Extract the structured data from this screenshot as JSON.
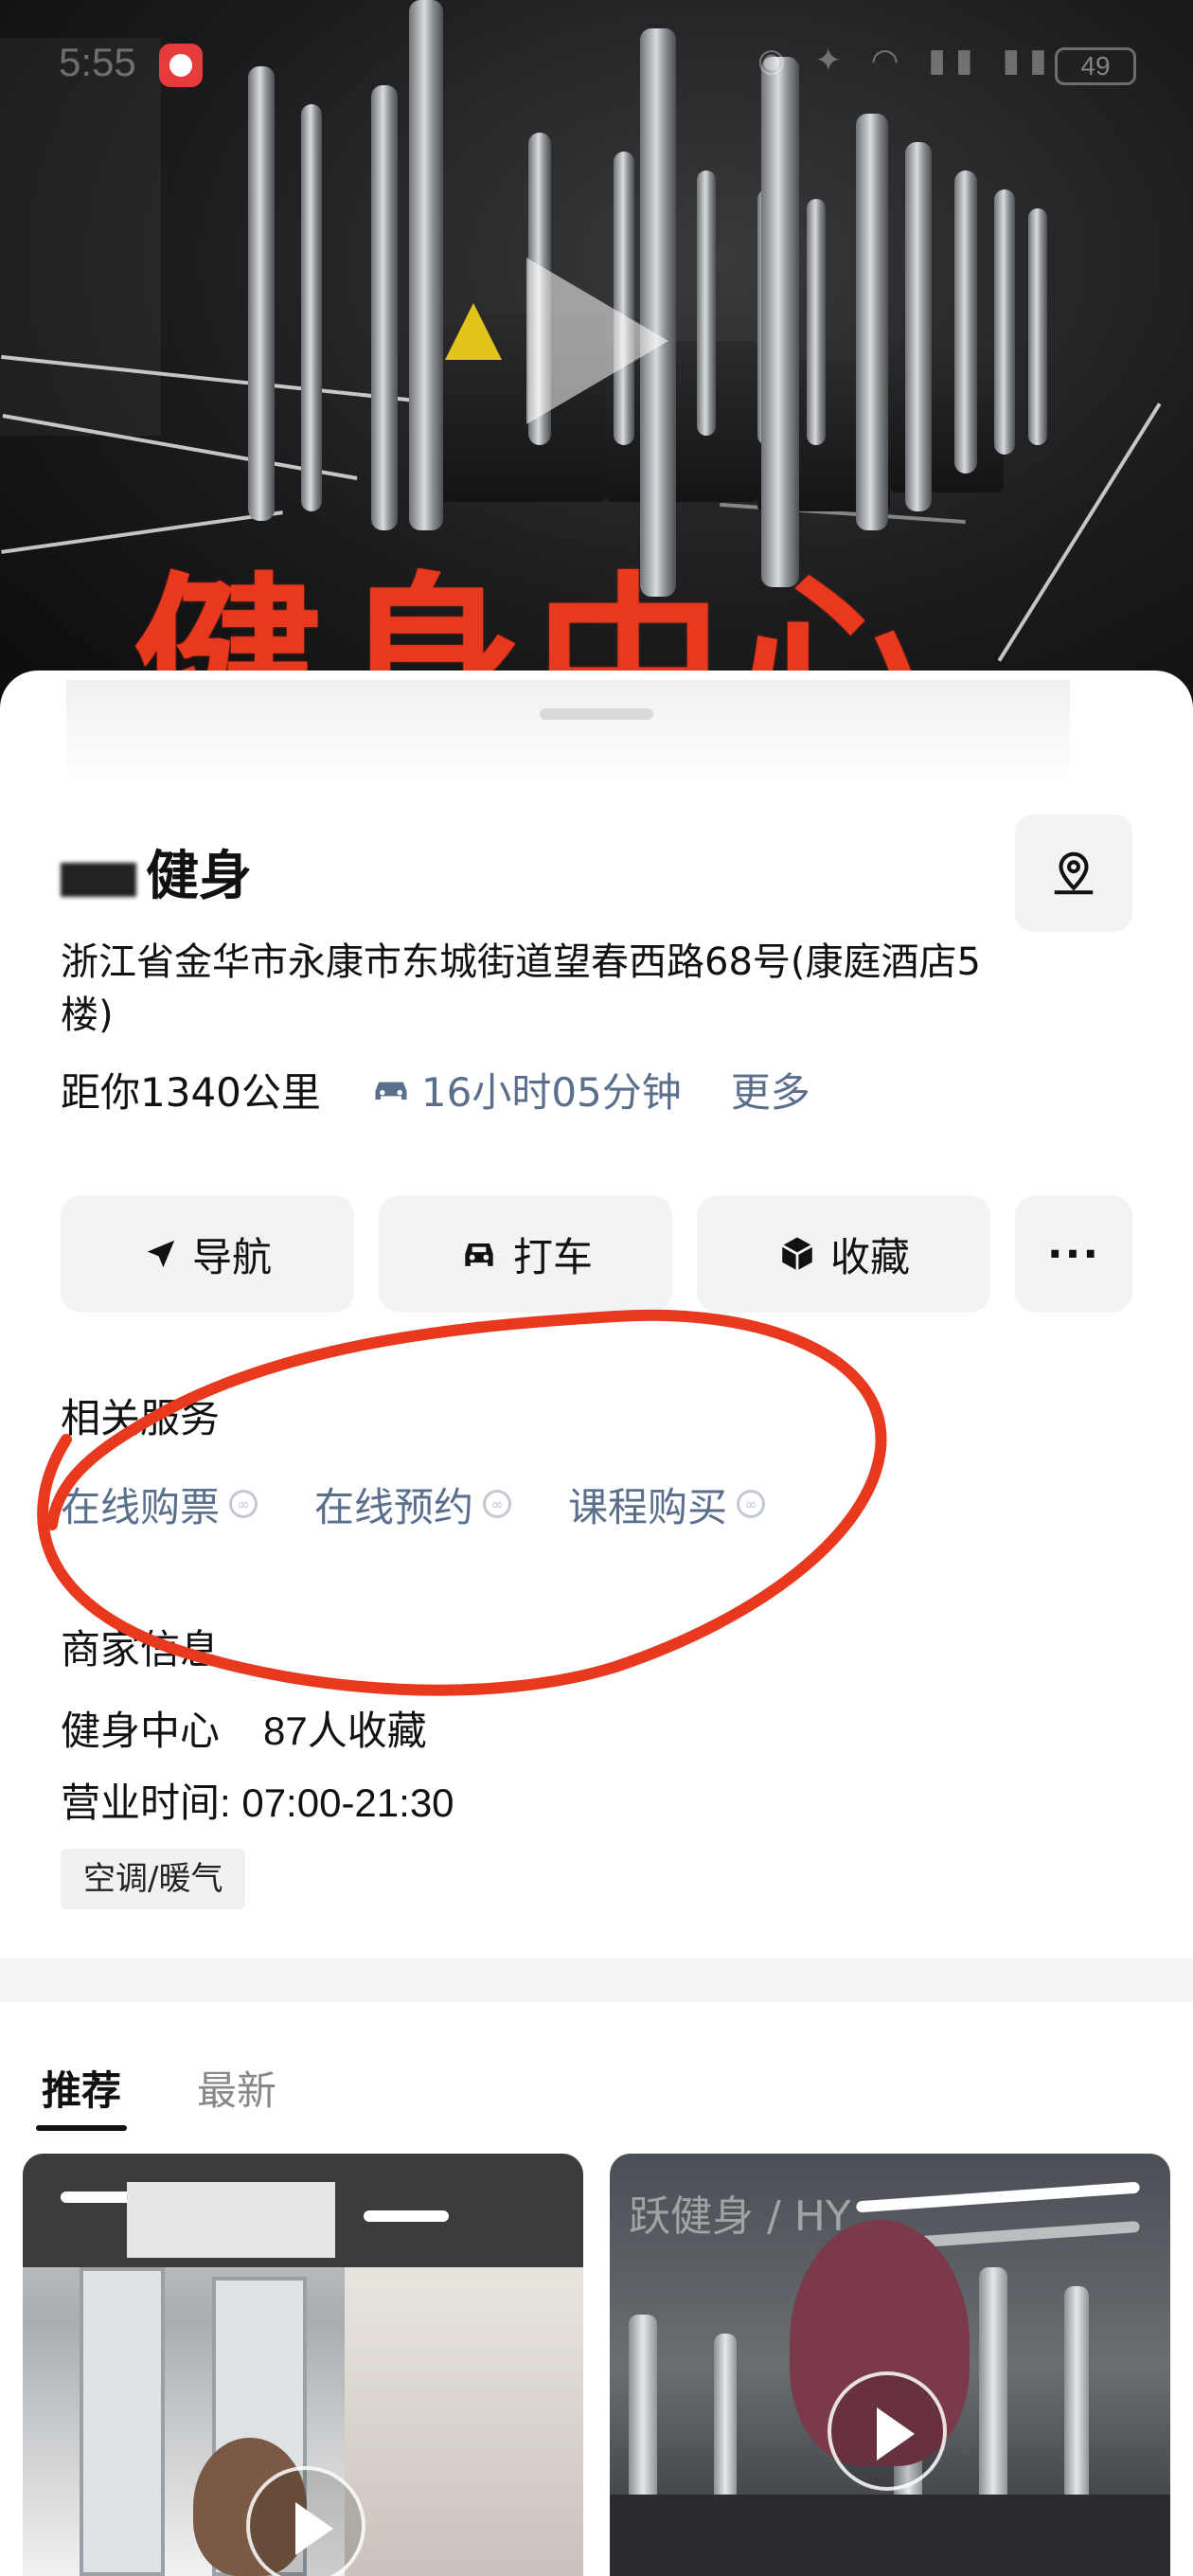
{
  "status_bar": {
    "time": "5:55",
    "battery": "49"
  },
  "hero": {
    "overlay_title": "健身中心"
  },
  "shop": {
    "name": "健身",
    "address": "浙江省金华市永康市东城街道望春西路68号(康庭酒店5楼)",
    "distance": "距你1340公里",
    "drive_time": "16小时05分钟",
    "more": "更多"
  },
  "actions": {
    "navigate": "导航",
    "taxi": "打车",
    "favorite": "收藏",
    "more_icon": "ellipsis-icon"
  },
  "services": {
    "title": "相关服务",
    "items": [
      "在线购票",
      "在线预约",
      "课程购买"
    ]
  },
  "merchant": {
    "title": "商家信息",
    "category": "健身中心",
    "favorites": "87人收藏",
    "hours": "营业时间: 07:00-21:30",
    "tag": "空调/暖气"
  },
  "feed": {
    "tabs": [
      "推荐",
      "最新"
    ],
    "right_card_wall_text": "跃健身 / HY"
  },
  "colors": {
    "accent_link": "#5a6f8c",
    "annotation_red": "#e8391f"
  }
}
